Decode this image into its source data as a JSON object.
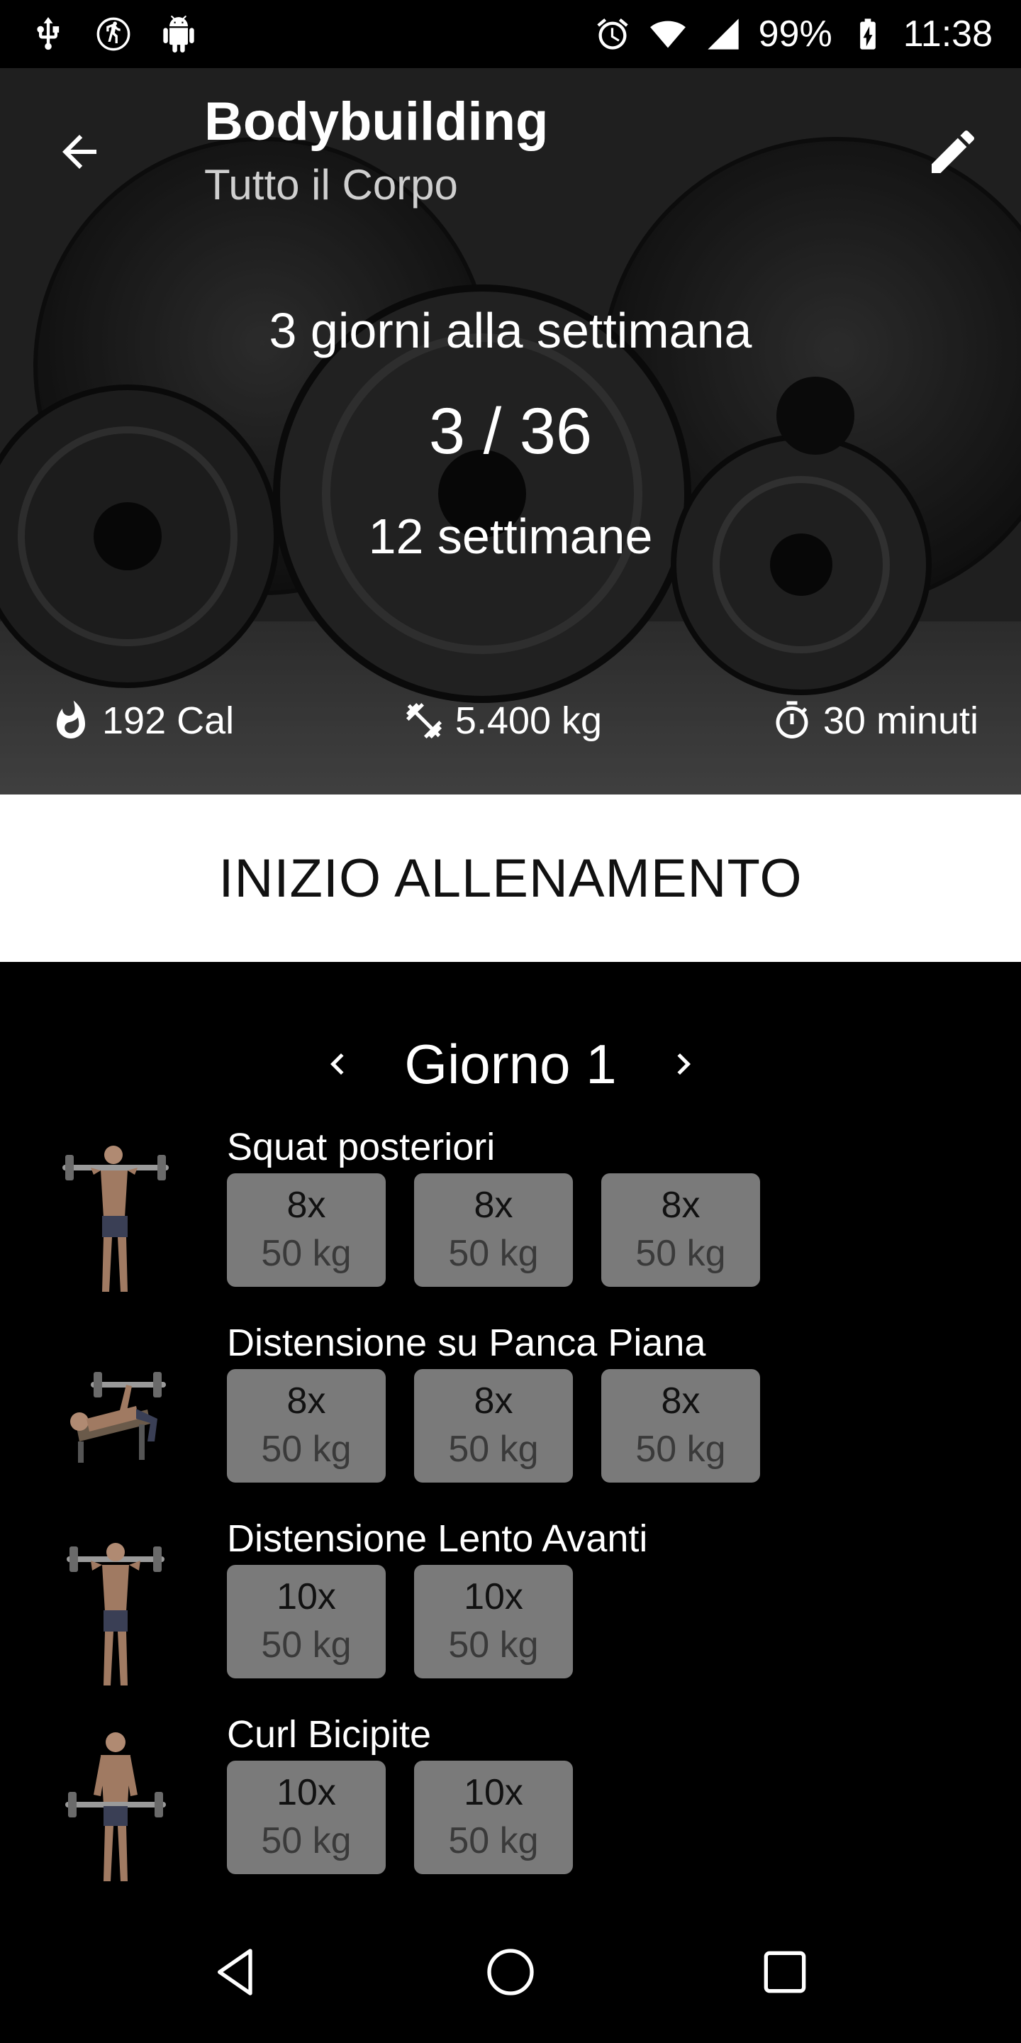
{
  "status_bar": {
    "battery": "99%",
    "time": "11:38",
    "left_icons": [
      "usb-icon",
      "running-icon",
      "android-icon"
    ],
    "right_icons": [
      "alarm-icon",
      "wifi-icon",
      "signal-icon",
      "battery-charging-icon"
    ]
  },
  "header": {
    "title": "Bodybuilding",
    "subtitle": "Tutto il Corpo"
  },
  "plan": {
    "frequency": "3 giorni alla settimana",
    "progress": "3 / 36",
    "duration": "12 settimane"
  },
  "stats": {
    "calories": "192 Cal",
    "weight": "5.400 kg",
    "time": "30 minuti"
  },
  "start_button": "INIZIO ALLENAMENTO",
  "day_nav": {
    "label": "Giorno 1"
  },
  "exercises": [
    {
      "name": "Squat posteriori",
      "sets": [
        {
          "reps": "8x",
          "weight": "50 kg"
        },
        {
          "reps": "8x",
          "weight": "50 kg"
        },
        {
          "reps": "8x",
          "weight": "50 kg"
        }
      ]
    },
    {
      "name": "Distensione su Panca Piana",
      "sets": [
        {
          "reps": "8x",
          "weight": "50 kg"
        },
        {
          "reps": "8x",
          "weight": "50 kg"
        },
        {
          "reps": "8x",
          "weight": "50 kg"
        }
      ]
    },
    {
      "name": "Distensione Lento Avanti",
      "sets": [
        {
          "reps": "10x",
          "weight": "50 kg"
        },
        {
          "reps": "10x",
          "weight": "50 kg"
        }
      ]
    },
    {
      "name": "Curl Bicipite",
      "sets": [
        {
          "reps": "10x",
          "weight": "50 kg"
        },
        {
          "reps": "10x",
          "weight": "50 kg"
        }
      ]
    }
  ],
  "colors": {
    "background": "#000000",
    "set_tile": "#7a7a7a",
    "start_button_bg": "#ffffff"
  }
}
